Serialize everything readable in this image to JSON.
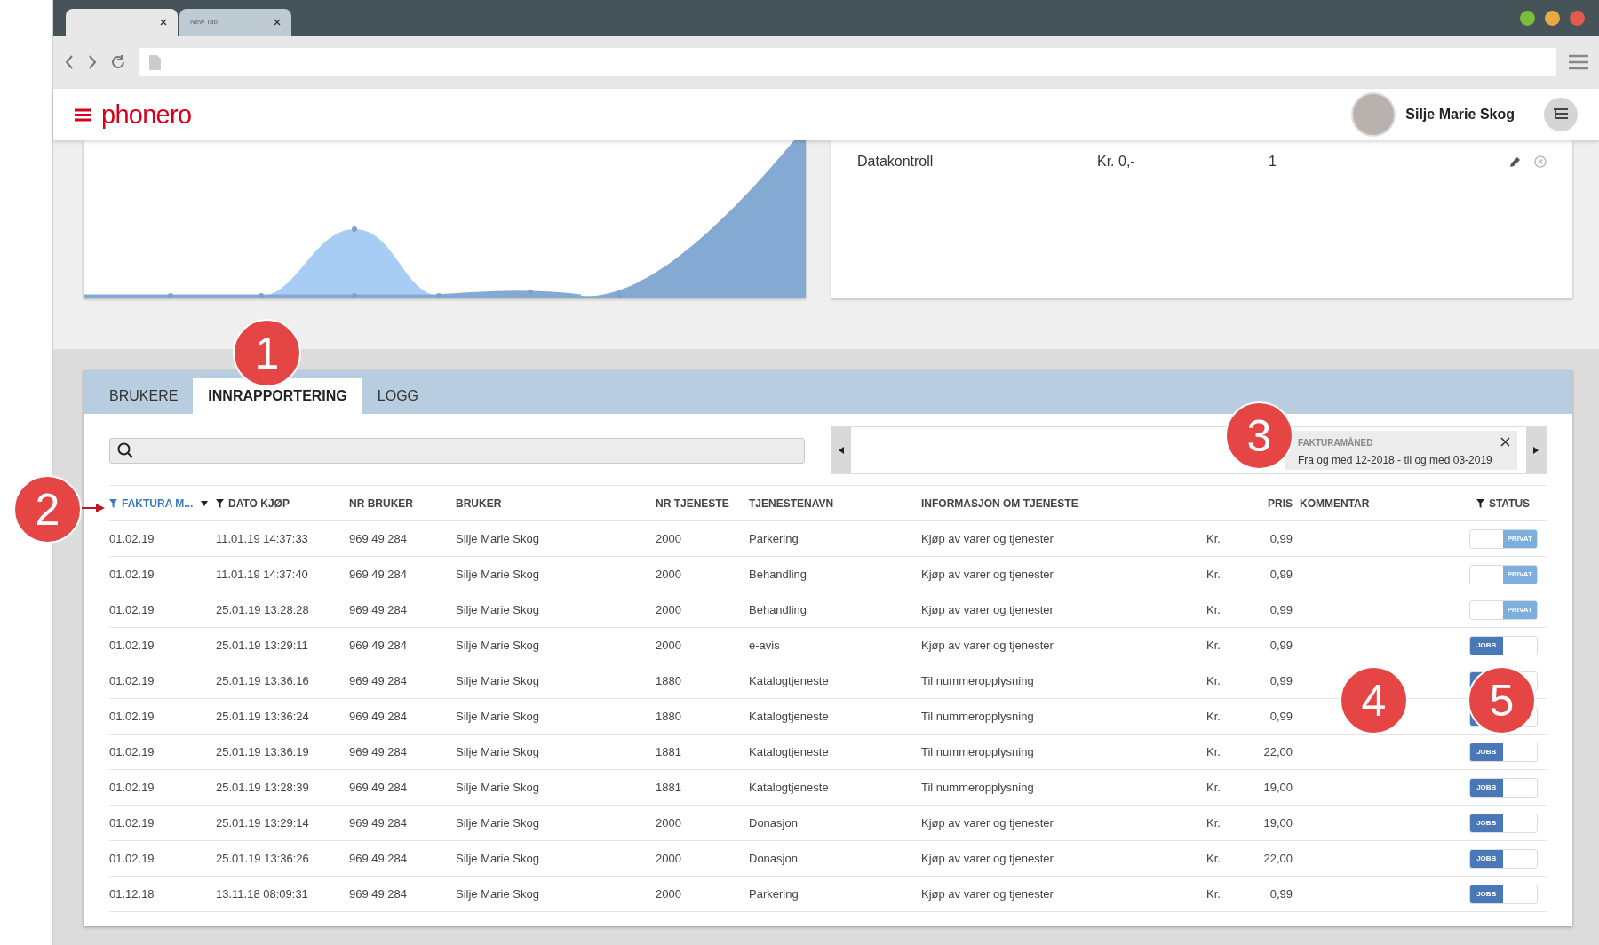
{
  "browser": {
    "tabs": [
      {
        "selected": true
      },
      {
        "label": "New Tab",
        "selected": false
      }
    ]
  },
  "app_header": {
    "logo": "phonero",
    "user_name": "Silje Marie Skog"
  },
  "services_card": {
    "rows": [
      {
        "name": "Datakontroll",
        "price": "Kr. 0,-",
        "count": "1"
      }
    ]
  },
  "panel": {
    "tabs": [
      {
        "label": "BRUKERE",
        "selected": false
      },
      {
        "label": "INNRAPPORTERING",
        "selected": true
      },
      {
        "label": "LOGG",
        "selected": false
      }
    ],
    "filter_chip": {
      "label": "FAKTURAMÅNED",
      "value": "Fra og med 12-2018 - til og med 03-2019"
    },
    "table": {
      "columns": [
        {
          "label": "FAKTURA M...",
          "filtered": true,
          "filter_active": true,
          "dropdown": true
        },
        {
          "label": "DATO KJØP",
          "filtered": true,
          "filter_active": false,
          "dropdown": false
        },
        {
          "label": "NR BRUKER",
          "filtered": false,
          "filter_active": false,
          "dropdown": false
        },
        {
          "label": "BRUKER",
          "filtered": false,
          "filter_active": false,
          "dropdown": false
        },
        {
          "label": "NR TJENESTE",
          "filtered": false,
          "filter_active": false,
          "dropdown": false
        },
        {
          "label": "TJENESTENAVN",
          "filtered": false,
          "filter_active": false,
          "dropdown": false
        },
        {
          "label": "INFORMASJON OM TJENESTE",
          "filtered": false,
          "filter_active": false,
          "dropdown": false
        },
        {
          "label": "PRIS",
          "filtered": false,
          "filter_active": false,
          "dropdown": false
        },
        {
          "label": "KOMMENTAR",
          "filtered": false,
          "filter_active": false,
          "dropdown": false
        },
        {
          "label": "STATUS",
          "filtered": true,
          "filter_active": false,
          "dropdown": false
        }
      ],
      "rows": [
        {
          "cells": [
            "01.02.19",
            "11.01.19 14:37:33",
            "969 49 284",
            "Silje Marie Skog",
            "2000",
            "Parkering",
            "Kjøp av varer og tjenester"
          ],
          "currency": "Kr.",
          "price": "0,99",
          "status": {
            "kind": "privat",
            "label": "PRIVAT"
          }
        },
        {
          "cells": [
            "01.02.19",
            "11.01.19 14:37:40",
            "969 49 284",
            "Silje Marie Skog",
            "2000",
            "Behandling",
            "Kjøp av varer og tjenester"
          ],
          "currency": "Kr.",
          "price": "0,99",
          "status": {
            "kind": "privat",
            "label": "PRIVAT"
          }
        },
        {
          "cells": [
            "01.02.19",
            "25.01.19 13:28:28",
            "969 49 284",
            "Silje Marie Skog",
            "2000",
            "Behandling",
            "Kjøp av varer og tjenester"
          ],
          "currency": "Kr.",
          "price": "0,99",
          "status": {
            "kind": "privat",
            "label": "PRIVAT"
          }
        },
        {
          "cells": [
            "01.02.19",
            "25.01.19 13:29:11",
            "969 49 284",
            "Silje Marie Skog",
            "2000",
            "e-avis",
            "Kjøp av varer og tjenester"
          ],
          "currency": "Kr.",
          "price": "0,99",
          "status": {
            "kind": "jobb",
            "label": "JOBB"
          }
        },
        {
          "cells": [
            "01.02.19",
            "25.01.19 13:36:16",
            "969 49 284",
            "Silje Marie Skog",
            "1880",
            "Katalogtjeneste",
            "Til nummeropplysning"
          ],
          "currency": "Kr.",
          "price": "0,99",
          "status": {
            "kind": "jobb"
          }
        },
        {
          "cells": [
            "01.02.19",
            "25.01.19 13:36:24",
            "969 49 284",
            "Silje Marie Skog",
            "1880",
            "Katalogtjeneste",
            "Til nummeropplysning"
          ],
          "currency": "Kr.",
          "price": "0,99",
          "status": {
            "kind": "jobb"
          }
        },
        {
          "cells": [
            "01.02.19",
            "25.01.19 13:36:19",
            "969 49 284",
            "Silje Marie Skog",
            "1881",
            "Katalogtjeneste",
            "Til nummeropplysning"
          ],
          "currency": "Kr.",
          "price": "22,00",
          "status": {
            "kind": "jobb",
            "label": "JOBB"
          }
        },
        {
          "cells": [
            "01.02.19",
            "25.01.19 13:28:39",
            "969 49 284",
            "Silje Marie Skog",
            "1881",
            "Katalogtjeneste",
            "Til nummeropplysning"
          ],
          "currency": "Kr.",
          "price": "19,00",
          "status": {
            "kind": "jobb",
            "label": "JOBB"
          }
        },
        {
          "cells": [
            "01.02.19",
            "25.01.19 13:29:14",
            "969 49 284",
            "Silje Marie Skog",
            "2000",
            "Donasjon",
            "Kjøp av varer og tjenester"
          ],
          "currency": "Kr.",
          "price": "19,00",
          "status": {
            "kind": "jobb",
            "label": "JOBB"
          }
        },
        {
          "cells": [
            "01.02.19",
            "25.01.19 13:36:26",
            "969 49 284",
            "Silje Marie Skog",
            "2000",
            "Donasjon",
            "Kjøp av varer og tjenester"
          ],
          "currency": "Kr.",
          "price": "22,00",
          "status": {
            "kind": "jobb",
            "label": "JOBB"
          }
        },
        {
          "cells": [
            "01.12.18",
            "13.11.18 08:09:31",
            "969 49 284",
            "Silje Marie Skog",
            "2000",
            "Parkering",
            "Kjøp av varer og tjenester"
          ],
          "currency": "Kr.",
          "price": "0,99",
          "status": {
            "kind": "jobb",
            "label": "JOBB"
          }
        }
      ]
    }
  },
  "callouts": [
    {
      "label": "1"
    },
    {
      "label": "2"
    },
    {
      "label": "3"
    },
    {
      "label": "4"
    },
    {
      "label": "5"
    }
  ]
}
